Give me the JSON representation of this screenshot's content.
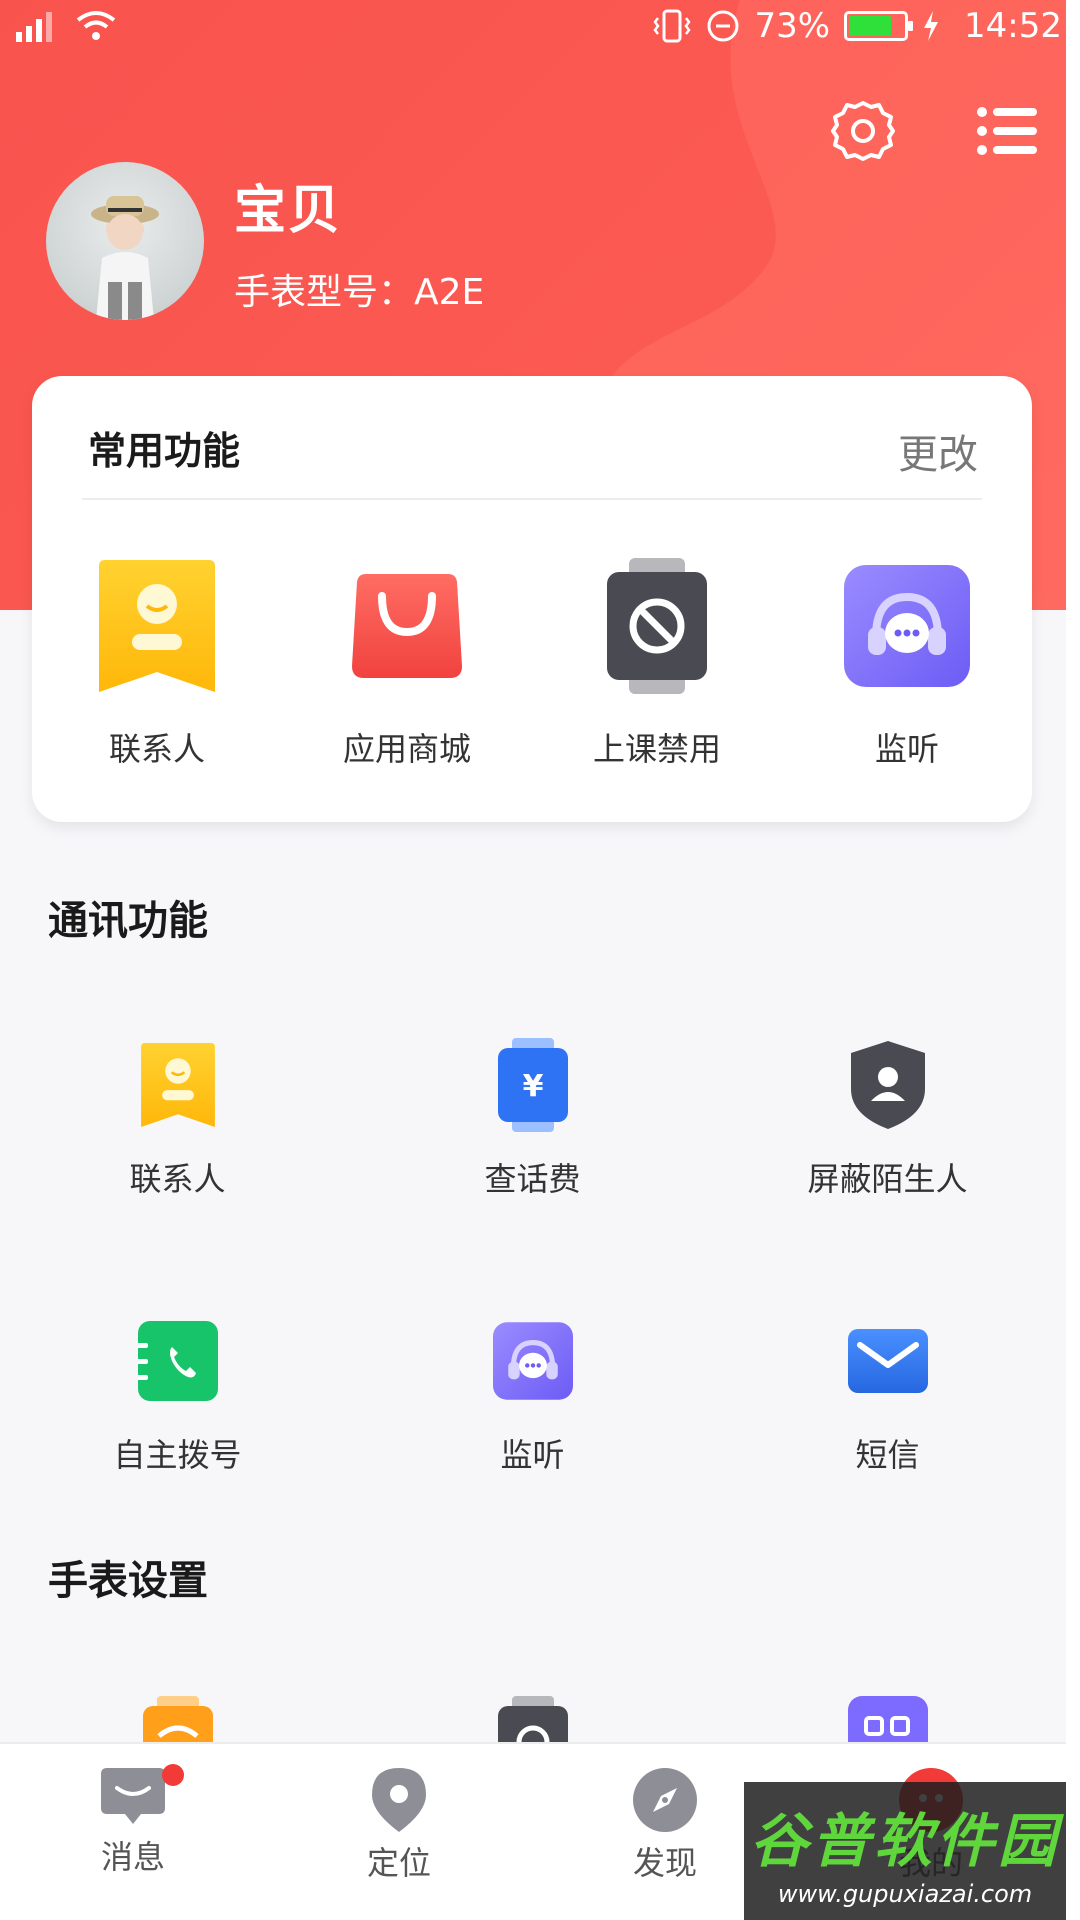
{
  "status_bar": {
    "battery": "73%",
    "battery_level": 0.73,
    "time": "14:52"
  },
  "header": {
    "profile_name": "宝贝",
    "model_label": "手表型号：A2E",
    "icons": [
      "settings-icon",
      "menu-icon"
    ]
  },
  "favorites": {
    "title": "常用功能",
    "edit_label": "更改",
    "items": [
      {
        "label": "联系人",
        "icon": "contacts-icon"
      },
      {
        "label": "应用商城",
        "icon": "shopping-bag-icon"
      },
      {
        "label": "上课禁用",
        "icon": "class-disable-icon"
      },
      {
        "label": "监听",
        "icon": "monitor-icon"
      }
    ]
  },
  "communication": {
    "title": "通讯功能",
    "items": [
      {
        "label": "联系人",
        "icon": "contacts-icon"
      },
      {
        "label": "查话费",
        "icon": "phone-bill-icon"
      },
      {
        "label": "屏蔽陌生人",
        "icon": "block-stranger-icon"
      },
      {
        "label": "自主拨号",
        "icon": "dial-icon"
      },
      {
        "label": "监听",
        "icon": "monitor-icon"
      },
      {
        "label": "短信",
        "icon": "sms-icon"
      }
    ]
  },
  "watch_settings": {
    "title": "手表设置"
  },
  "bottom_nav": {
    "items": [
      {
        "label": "消息",
        "icon": "message-icon"
      },
      {
        "label": "定位",
        "icon": "location-icon"
      },
      {
        "label": "发现",
        "icon": "compass-icon"
      },
      {
        "label": "我的",
        "icon": "profile-icon"
      }
    ]
  },
  "watermark": {
    "title": "谷普软件园",
    "url": "www.gupuxiazai.com"
  },
  "colors": {
    "brand_red": "#f9534e",
    "contacts_yellow": "#ffc21a",
    "shop_red": "#f5504f",
    "watch_dark": "#4a4a52",
    "monitor_purple": "#7d6bff",
    "bill_blue": "#3279ff",
    "dial_green": "#17c46a",
    "sms_blue": "#2f7bf0"
  }
}
